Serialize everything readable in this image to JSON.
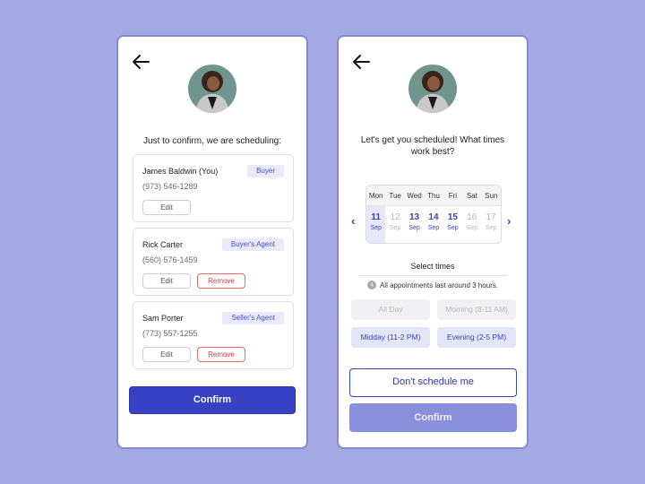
{
  "colors": {
    "background": "#a5a9e3",
    "primary": "#3642c3",
    "primary_disabled": "#8a8fdb",
    "danger": "#d83a3a",
    "badge_bg": "#e9eaf9"
  },
  "screen_confirm": {
    "back_icon": "arrow-left-icon",
    "avatar": "agent-photo",
    "heading": "Just to confirm, we are scheduling:",
    "participants": [
      {
        "name": "James Baldwin (You)",
        "phone": "(973) 546-1289",
        "role": "Buyer",
        "edit_label": "Edit",
        "remove_label": null
      },
      {
        "name": "Rick Carter",
        "phone": "(560) 576-1459",
        "role": "Buyer's Agent",
        "edit_label": "Edit",
        "remove_label": "Remove"
      },
      {
        "name": "Sam Porter",
        "phone": "(773) 557-1255",
        "role": "Seller's Agent",
        "edit_label": "Edit",
        "remove_label": "Remove"
      }
    ],
    "confirm_label": "Confirm"
  },
  "screen_schedule": {
    "back_icon": "arrow-left-icon",
    "avatar": "agent-photo",
    "heading": "Let's get you scheduled! What times work best?",
    "calendar": {
      "prev_icon": "chevron-left-icon",
      "next_icon": "chevron-right-icon",
      "weekdays": [
        "Mon",
        "Tue",
        "Wed",
        "Thu",
        "Fri",
        "Sat",
        "Sun"
      ],
      "days": [
        {
          "num": "11",
          "month": "Sep",
          "available": true,
          "selected": true
        },
        {
          "num": "12",
          "month": "Sep",
          "available": false,
          "selected": false
        },
        {
          "num": "13",
          "month": "Sep",
          "available": true,
          "selected": false
        },
        {
          "num": "14",
          "month": "Sep",
          "available": true,
          "selected": false
        },
        {
          "num": "15",
          "month": "Sep",
          "available": true,
          "selected": false
        },
        {
          "num": "16",
          "month": "Sep",
          "available": false,
          "selected": false
        },
        {
          "num": "17",
          "month": "Sep",
          "available": false,
          "selected": false
        }
      ]
    },
    "select_times_label": "Select times",
    "duration_note": "All appointments last around 3 hours.",
    "time_slots": [
      {
        "label": "All Day",
        "enabled": false
      },
      {
        "label": "Morning (8-11 AM)",
        "enabled": false
      },
      {
        "label": "Midday (11-2 PM)",
        "enabled": true
      },
      {
        "label": "Evening (2-5 PM)",
        "enabled": true
      }
    ],
    "dont_schedule_label": "Don't schedule me",
    "confirm_label": "Confirm"
  }
}
